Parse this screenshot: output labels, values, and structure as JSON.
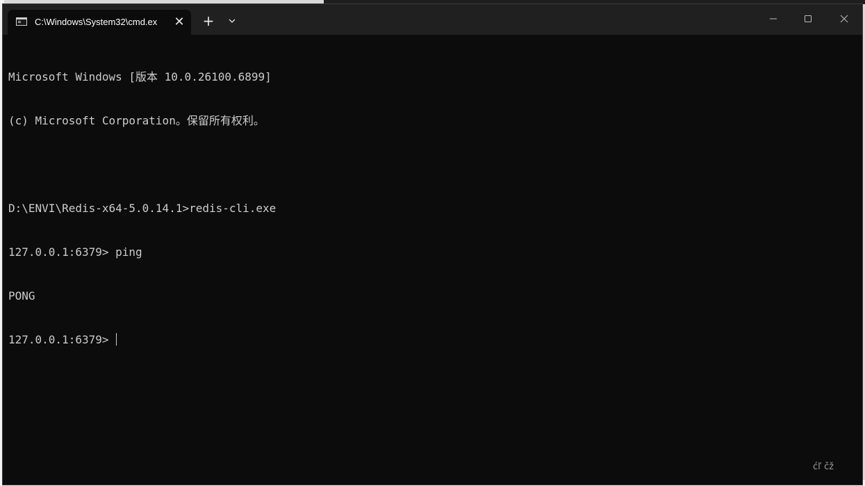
{
  "tab": {
    "title": "C:\\Windows\\System32\\cmd.ex",
    "close_glyph": "✕",
    "icon": "terminal-icon"
  },
  "titlebar": {
    "new_tab_glyph": "+",
    "dropdown_icon": "chevron-down-icon",
    "minimize_icon": "minimize-icon",
    "maximize_icon": "maximize-icon",
    "close_icon": "close-icon"
  },
  "console": {
    "lines": [
      "Microsoft Windows [版本 10.0.26100.6899]",
      "(c) Microsoft Corporation。保留所有权利。",
      "",
      "D:\\ENVI\\Redis-x64-5.0.14.1>redis-cli.exe",
      "127.0.0.1:6379> ping",
      "PONG"
    ],
    "prompt": "127.0.0.1:6379> "
  },
  "status": {
    "text": "ćľ čž"
  },
  "colors": {
    "console_bg": "#0c0c0c",
    "titlebar_bg": "#202020",
    "text": "#cccccc"
  }
}
